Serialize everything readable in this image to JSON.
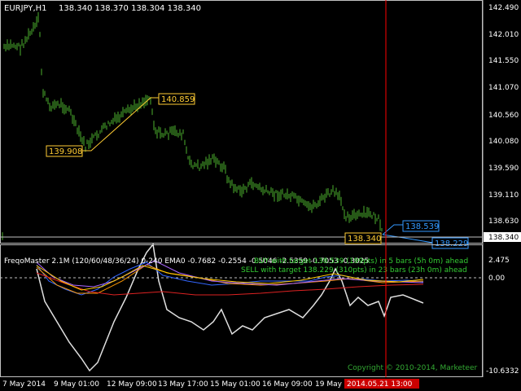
{
  "header": {
    "symbol": "EURJPY,H1",
    "ohlc": "138.340 138.370 138.304 138.340"
  },
  "price_axis": {
    "ticks": [
      "142.490",
      "142.010",
      "141.550",
      "141.070",
      "140.560",
      "140.080",
      "139.590",
      "139.110",
      "138.630",
      "138.340"
    ],
    "current_price": "138.340"
  },
  "price_labels": {
    "low_marker": "139.908",
    "high_marker": "140.859",
    "current_marker": "138.340",
    "forecast_high": "138.539",
    "forecast_low": "138.229"
  },
  "indicator": {
    "title": "FreqoMaster 2.1M  (120/60/48/36/24) 0-240 EMA0 -0.7682 -0.2554 -0.5046 -2.5359 -0.7053 -0.3025",
    "signal_buy_text": "BUY with target 138.539 (199pts) in 5 bars (5h 0m) ahead",
    "signal_sell_text": "SELL with target 138.229 (310pts) in 23 bars (23h 0m) ahead",
    "copyright": "Copyright © 2010-2014, Marketeer",
    "axis_top": "2.475",
    "axis_zero": "0.00",
    "axis_bottom": "-10.6332"
  },
  "time_axis": {
    "labels": [
      "7 May 2014",
      "9 May 01:00",
      "12 May 09:00",
      "13 May 17:00",
      "15 May 01:00",
      "16 May 09:00",
      "19 May 17:"
    ],
    "cursor_label": "2014.05.21 13:00"
  },
  "colors": {
    "background": "#000000",
    "candles": "#4caf2e",
    "grid": "#c0c0c0",
    "cursor": "#ff0000",
    "low_marker": "#ffcc33",
    "forecast": "#3399ff",
    "white_line": "#e0e0e0",
    "buy_text": "#33cc33",
    "sell_text": "#33cc33",
    "copyright_text": "#33aa33"
  }
}
